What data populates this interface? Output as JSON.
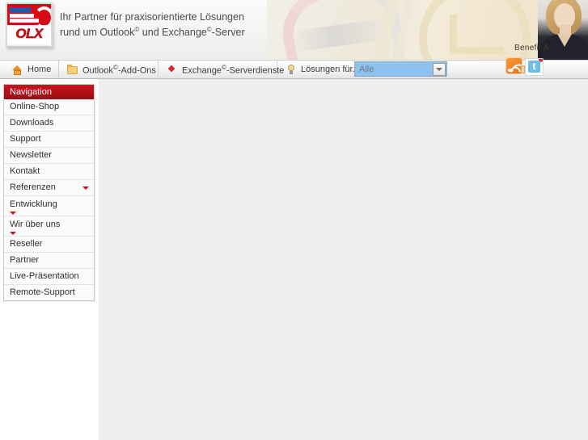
{
  "header": {
    "logo_text": "OLX",
    "logo_name": "olx-logo",
    "tagline_line1": "Ihr Partner für praxisorientierte Lösungen",
    "tagline_line2_a": "rund um Outlook",
    "tagline_sup1": "©",
    "tagline_line2_b": " und Exchange",
    "tagline_sup2": "©",
    "tagline_line2_c": "-Server",
    "benefit_text": "Benefit A"
  },
  "tabs": [
    {
      "id": "home",
      "label": "Home",
      "icon": "home-icon"
    },
    {
      "id": "outlook",
      "label_a": "Outlook",
      "sup": "©",
      "label_b": "-Add-Ons",
      "icon": "folder-icon"
    },
    {
      "id": "exchange",
      "label_a": "Exchange",
      "sup": "©",
      "label_b": "-Serverdienste",
      "icon": "exchange-icon"
    },
    {
      "id": "loesung",
      "label": "Lösungen für...",
      "icon": "lightbulb-icon"
    }
  ],
  "filter_select": {
    "value": "Alle",
    "arrow": "chevron-down-icon"
  },
  "social": [
    {
      "id": "rss",
      "name": "rss-feed-icon"
    },
    {
      "id": "twitter",
      "name": "twitter-icon",
      "glyph": "t"
    }
  ],
  "sidebar": {
    "header": "Navigation",
    "items": [
      {
        "label": "Online-Shop",
        "submenu": false,
        "wrap": false
      },
      {
        "label": "Downloads",
        "submenu": false,
        "wrap": false
      },
      {
        "label": "Support",
        "submenu": false,
        "wrap": false
      },
      {
        "label": "Newsletter",
        "submenu": false,
        "wrap": false
      },
      {
        "label": "Kontakt",
        "submenu": false,
        "wrap": false
      },
      {
        "label": "Referenzen",
        "submenu": true,
        "wrap": false
      },
      {
        "label": "Entwicklung",
        "submenu": true,
        "wrap": true
      },
      {
        "label": "Wir über uns",
        "submenu": true,
        "wrap": true
      },
      {
        "label": "Reseller",
        "submenu": false,
        "wrap": false
      },
      {
        "label": "Partner",
        "submenu": false,
        "wrap": false
      },
      {
        "label": "Live-Präsentation",
        "submenu": false,
        "wrap": false
      },
      {
        "label": "Remote-Support",
        "submenu": false,
        "wrap": false
      }
    ]
  },
  "colors": {
    "brand_red": "#c8141e",
    "accent_orange": "#ec7016",
    "select_blue": "#8dc2ef",
    "content_grey": "#eeeeee"
  }
}
